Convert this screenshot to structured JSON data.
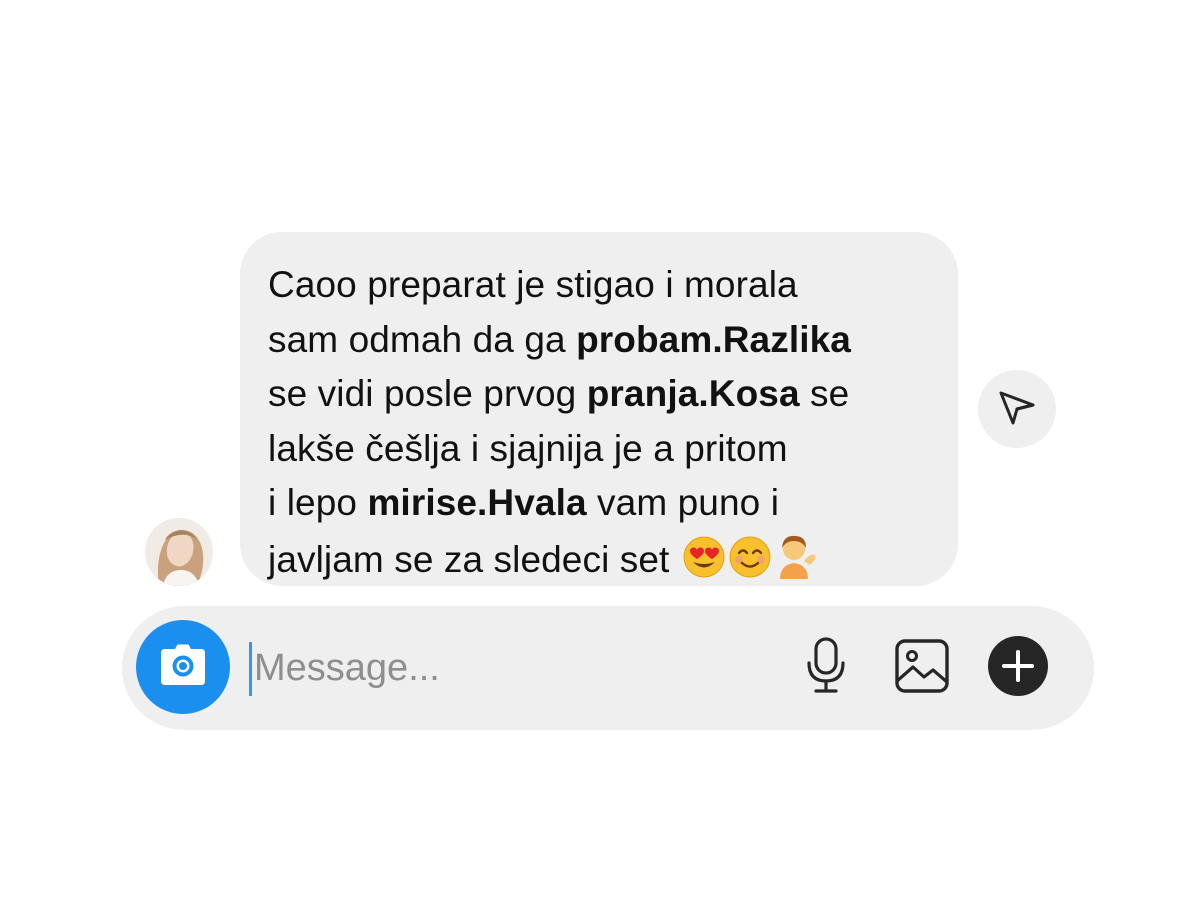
{
  "message": {
    "lines": [
      [
        {
          "t": "Caoo preparat je stigao i morala"
        }
      ],
      [
        {
          "t": "sam odmah da ga "
        },
        {
          "b": "probam.Razlika"
        }
      ],
      [
        {
          "t": "se vidi posle prvog "
        },
        {
          "b": "pranja.Kosa"
        },
        {
          "t": " se"
        }
      ],
      [
        {
          "t": "lakše češlja i sjajnija je a pritom"
        }
      ],
      [
        {
          "t": "i lepo "
        },
        {
          "b": "mirise.Hvala"
        },
        {
          "t": " vam puno i"
        }
      ],
      [
        {
          "t": "javljam se za sledeci set "
        }
      ]
    ],
    "emojis": [
      "heart-eyes-emoji",
      "smiling-emoji",
      "person-tipping-hand-emoji"
    ]
  },
  "composer": {
    "placeholder": "Message..."
  },
  "icons": {
    "share": "paper-plane-icon",
    "camera": "camera-icon",
    "mic": "microphone-icon",
    "gallery": "image-icon",
    "plus": "plus-circle-icon"
  },
  "colors": {
    "bubble_bg": "#efefef",
    "camera_accent": "#1b8ff0",
    "text": "#111111",
    "placeholder": "#8e8e8e"
  }
}
